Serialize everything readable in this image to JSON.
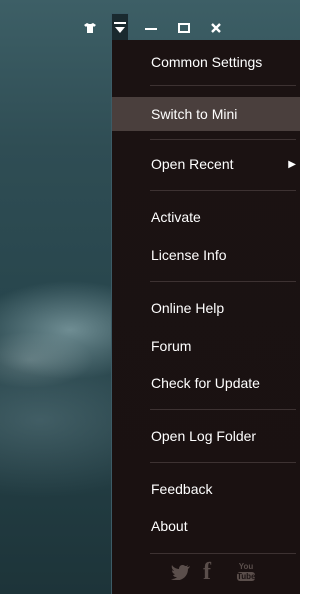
{
  "titlebar": {
    "skin_icon": "shirt-icon",
    "menu_icon": "dropdown-menu-icon",
    "minimize_icon": "minimize-icon",
    "maximize_icon": "maximize-icon",
    "close_icon": "close-icon"
  },
  "menu": {
    "items": [
      {
        "label": "Common Settings"
      },
      {
        "label": "Switch to Mini"
      },
      {
        "label": "Open Recent"
      },
      {
        "label": "Activate"
      },
      {
        "label": "License Info"
      },
      {
        "label": "Online Help"
      },
      {
        "label": "Forum"
      },
      {
        "label": "Check for Update"
      },
      {
        "label": "Open Log Folder"
      },
      {
        "label": "Feedback"
      },
      {
        "label": "About"
      }
    ],
    "social": {
      "twitter_icon": "twitter-icon",
      "facebook_icon": "facebook-icon",
      "youtube_icon": "youtube-icon",
      "youtube_text_top": "You",
      "youtube_text_bottom": "Tube"
    }
  },
  "colors": {
    "menu_bg": "#1b1212",
    "highlight": "#4a3f3d",
    "accent_border": "#3c5b66"
  }
}
